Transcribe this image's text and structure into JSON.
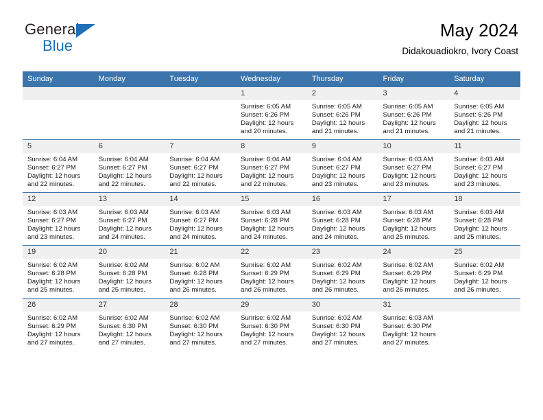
{
  "brand": {
    "name_part1": "General",
    "name_part2": "Blue"
  },
  "header": {
    "title": "May 2024",
    "subtitle": "Didakouadiokro, Ivory Coast"
  },
  "colors": {
    "header_blue": "#3b75ab",
    "logo_blue": "#1f6fb8",
    "daynum_bg": "#f0f0f0"
  },
  "weekdays": [
    "Sunday",
    "Monday",
    "Tuesday",
    "Wednesday",
    "Thursday",
    "Friday",
    "Saturday"
  ],
  "weeks": [
    [
      {
        "day": "",
        "empty": true
      },
      {
        "day": "",
        "empty": true
      },
      {
        "day": "",
        "empty": true
      },
      {
        "day": "1",
        "sunrise": "Sunrise: 6:05 AM",
        "sunset": "Sunset: 6:26 PM",
        "daylight1": "Daylight: 12 hours",
        "daylight2": "and 20 minutes."
      },
      {
        "day": "2",
        "sunrise": "Sunrise: 6:05 AM",
        "sunset": "Sunset: 6:26 PM",
        "daylight1": "Daylight: 12 hours",
        "daylight2": "and 21 minutes."
      },
      {
        "day": "3",
        "sunrise": "Sunrise: 6:05 AM",
        "sunset": "Sunset: 6:26 PM",
        "daylight1": "Daylight: 12 hours",
        "daylight2": "and 21 minutes."
      },
      {
        "day": "4",
        "sunrise": "Sunrise: 6:05 AM",
        "sunset": "Sunset: 6:26 PM",
        "daylight1": "Daylight: 12 hours",
        "daylight2": "and 21 minutes."
      }
    ],
    [
      {
        "day": "5",
        "sunrise": "Sunrise: 6:04 AM",
        "sunset": "Sunset: 6:27 PM",
        "daylight1": "Daylight: 12 hours",
        "daylight2": "and 22 minutes."
      },
      {
        "day": "6",
        "sunrise": "Sunrise: 6:04 AM",
        "sunset": "Sunset: 6:27 PM",
        "daylight1": "Daylight: 12 hours",
        "daylight2": "and 22 minutes."
      },
      {
        "day": "7",
        "sunrise": "Sunrise: 6:04 AM",
        "sunset": "Sunset: 6:27 PM",
        "daylight1": "Daylight: 12 hours",
        "daylight2": "and 22 minutes."
      },
      {
        "day": "8",
        "sunrise": "Sunrise: 6:04 AM",
        "sunset": "Sunset: 6:27 PM",
        "daylight1": "Daylight: 12 hours",
        "daylight2": "and 22 minutes."
      },
      {
        "day": "9",
        "sunrise": "Sunrise: 6:04 AM",
        "sunset": "Sunset: 6:27 PM",
        "daylight1": "Daylight: 12 hours",
        "daylight2": "and 23 minutes."
      },
      {
        "day": "10",
        "sunrise": "Sunrise: 6:03 AM",
        "sunset": "Sunset: 6:27 PM",
        "daylight1": "Daylight: 12 hours",
        "daylight2": "and 23 minutes."
      },
      {
        "day": "11",
        "sunrise": "Sunrise: 6:03 AM",
        "sunset": "Sunset: 6:27 PM",
        "daylight1": "Daylight: 12 hours",
        "daylight2": "and 23 minutes."
      }
    ],
    [
      {
        "day": "12",
        "sunrise": "Sunrise: 6:03 AM",
        "sunset": "Sunset: 6:27 PM",
        "daylight1": "Daylight: 12 hours",
        "daylight2": "and 23 minutes."
      },
      {
        "day": "13",
        "sunrise": "Sunrise: 6:03 AM",
        "sunset": "Sunset: 6:27 PM",
        "daylight1": "Daylight: 12 hours",
        "daylight2": "and 24 minutes."
      },
      {
        "day": "14",
        "sunrise": "Sunrise: 6:03 AM",
        "sunset": "Sunset: 6:27 PM",
        "daylight1": "Daylight: 12 hours",
        "daylight2": "and 24 minutes."
      },
      {
        "day": "15",
        "sunrise": "Sunrise: 6:03 AM",
        "sunset": "Sunset: 6:28 PM",
        "daylight1": "Daylight: 12 hours",
        "daylight2": "and 24 minutes."
      },
      {
        "day": "16",
        "sunrise": "Sunrise: 6:03 AM",
        "sunset": "Sunset: 6:28 PM",
        "daylight1": "Daylight: 12 hours",
        "daylight2": "and 24 minutes."
      },
      {
        "day": "17",
        "sunrise": "Sunrise: 6:03 AM",
        "sunset": "Sunset: 6:28 PM",
        "daylight1": "Daylight: 12 hours",
        "daylight2": "and 25 minutes."
      },
      {
        "day": "18",
        "sunrise": "Sunrise: 6:03 AM",
        "sunset": "Sunset: 6:28 PM",
        "daylight1": "Daylight: 12 hours",
        "daylight2": "and 25 minutes."
      }
    ],
    [
      {
        "day": "19",
        "sunrise": "Sunrise: 6:02 AM",
        "sunset": "Sunset: 6:28 PM",
        "daylight1": "Daylight: 12 hours",
        "daylight2": "and 25 minutes."
      },
      {
        "day": "20",
        "sunrise": "Sunrise: 6:02 AM",
        "sunset": "Sunset: 6:28 PM",
        "daylight1": "Daylight: 12 hours",
        "daylight2": "and 25 minutes."
      },
      {
        "day": "21",
        "sunrise": "Sunrise: 6:02 AM",
        "sunset": "Sunset: 6:28 PM",
        "daylight1": "Daylight: 12 hours",
        "daylight2": "and 26 minutes."
      },
      {
        "day": "22",
        "sunrise": "Sunrise: 6:02 AM",
        "sunset": "Sunset: 6:29 PM",
        "daylight1": "Daylight: 12 hours",
        "daylight2": "and 26 minutes."
      },
      {
        "day": "23",
        "sunrise": "Sunrise: 6:02 AM",
        "sunset": "Sunset: 6:29 PM",
        "daylight1": "Daylight: 12 hours",
        "daylight2": "and 26 minutes."
      },
      {
        "day": "24",
        "sunrise": "Sunrise: 6:02 AM",
        "sunset": "Sunset: 6:29 PM",
        "daylight1": "Daylight: 12 hours",
        "daylight2": "and 26 minutes."
      },
      {
        "day": "25",
        "sunrise": "Sunrise: 6:02 AM",
        "sunset": "Sunset: 6:29 PM",
        "daylight1": "Daylight: 12 hours",
        "daylight2": "and 26 minutes."
      }
    ],
    [
      {
        "day": "26",
        "sunrise": "Sunrise: 6:02 AM",
        "sunset": "Sunset: 6:29 PM",
        "daylight1": "Daylight: 12 hours",
        "daylight2": "and 27 minutes."
      },
      {
        "day": "27",
        "sunrise": "Sunrise: 6:02 AM",
        "sunset": "Sunset: 6:30 PM",
        "daylight1": "Daylight: 12 hours",
        "daylight2": "and 27 minutes."
      },
      {
        "day": "28",
        "sunrise": "Sunrise: 6:02 AM",
        "sunset": "Sunset: 6:30 PM",
        "daylight1": "Daylight: 12 hours",
        "daylight2": "and 27 minutes."
      },
      {
        "day": "29",
        "sunrise": "Sunrise: 6:02 AM",
        "sunset": "Sunset: 6:30 PM",
        "daylight1": "Daylight: 12 hours",
        "daylight2": "and 27 minutes."
      },
      {
        "day": "30",
        "sunrise": "Sunrise: 6:02 AM",
        "sunset": "Sunset: 6:30 PM",
        "daylight1": "Daylight: 12 hours",
        "daylight2": "and 27 minutes."
      },
      {
        "day": "31",
        "sunrise": "Sunrise: 6:03 AM",
        "sunset": "Sunset: 6:30 PM",
        "daylight1": "Daylight: 12 hours",
        "daylight2": "and 27 minutes."
      },
      {
        "day": "",
        "empty": true
      }
    ]
  ]
}
